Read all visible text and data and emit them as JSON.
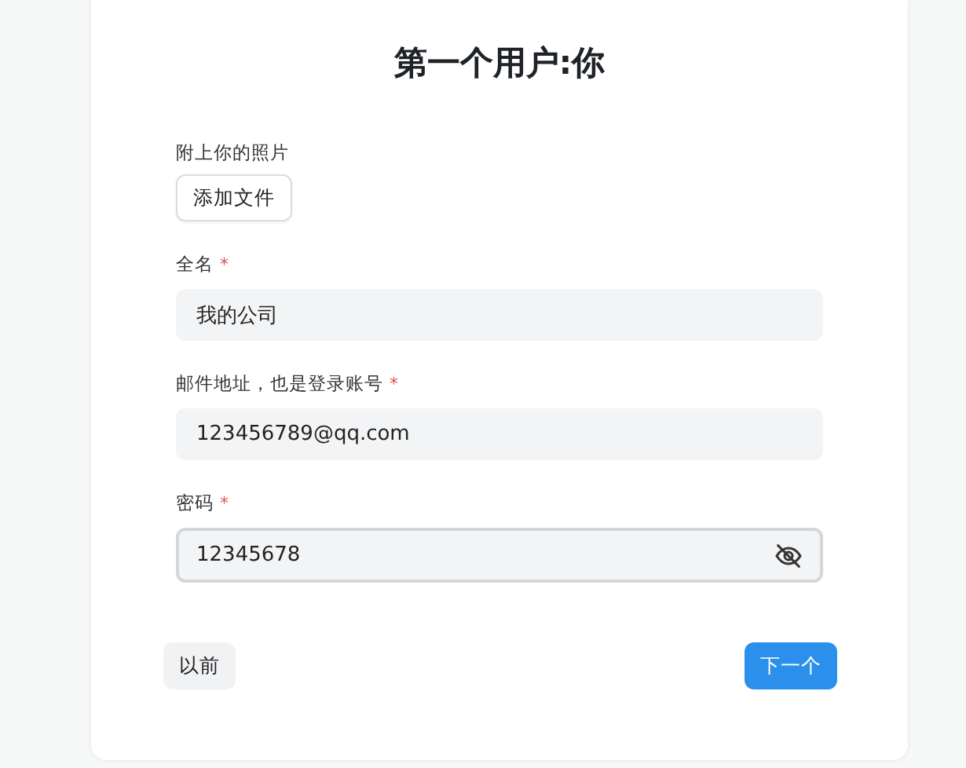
{
  "title": "第一个用户:你",
  "photo": {
    "label": "附上你的照片",
    "button": "添加文件"
  },
  "fields": [
    {
      "label": "全名",
      "required_mark": "*",
      "kind": "text",
      "value": "我的公司",
      "focused": false
    },
    {
      "label": "邮件地址，也是登录账号",
      "required_mark": "*",
      "kind": "text",
      "value": "123456789@qq.com",
      "focused": false
    },
    {
      "label": "密码",
      "required_mark": "*",
      "kind": "password",
      "value": "12345678",
      "focused": true
    }
  ],
  "buttons": {
    "back": "以前",
    "next": "下一个"
  }
}
